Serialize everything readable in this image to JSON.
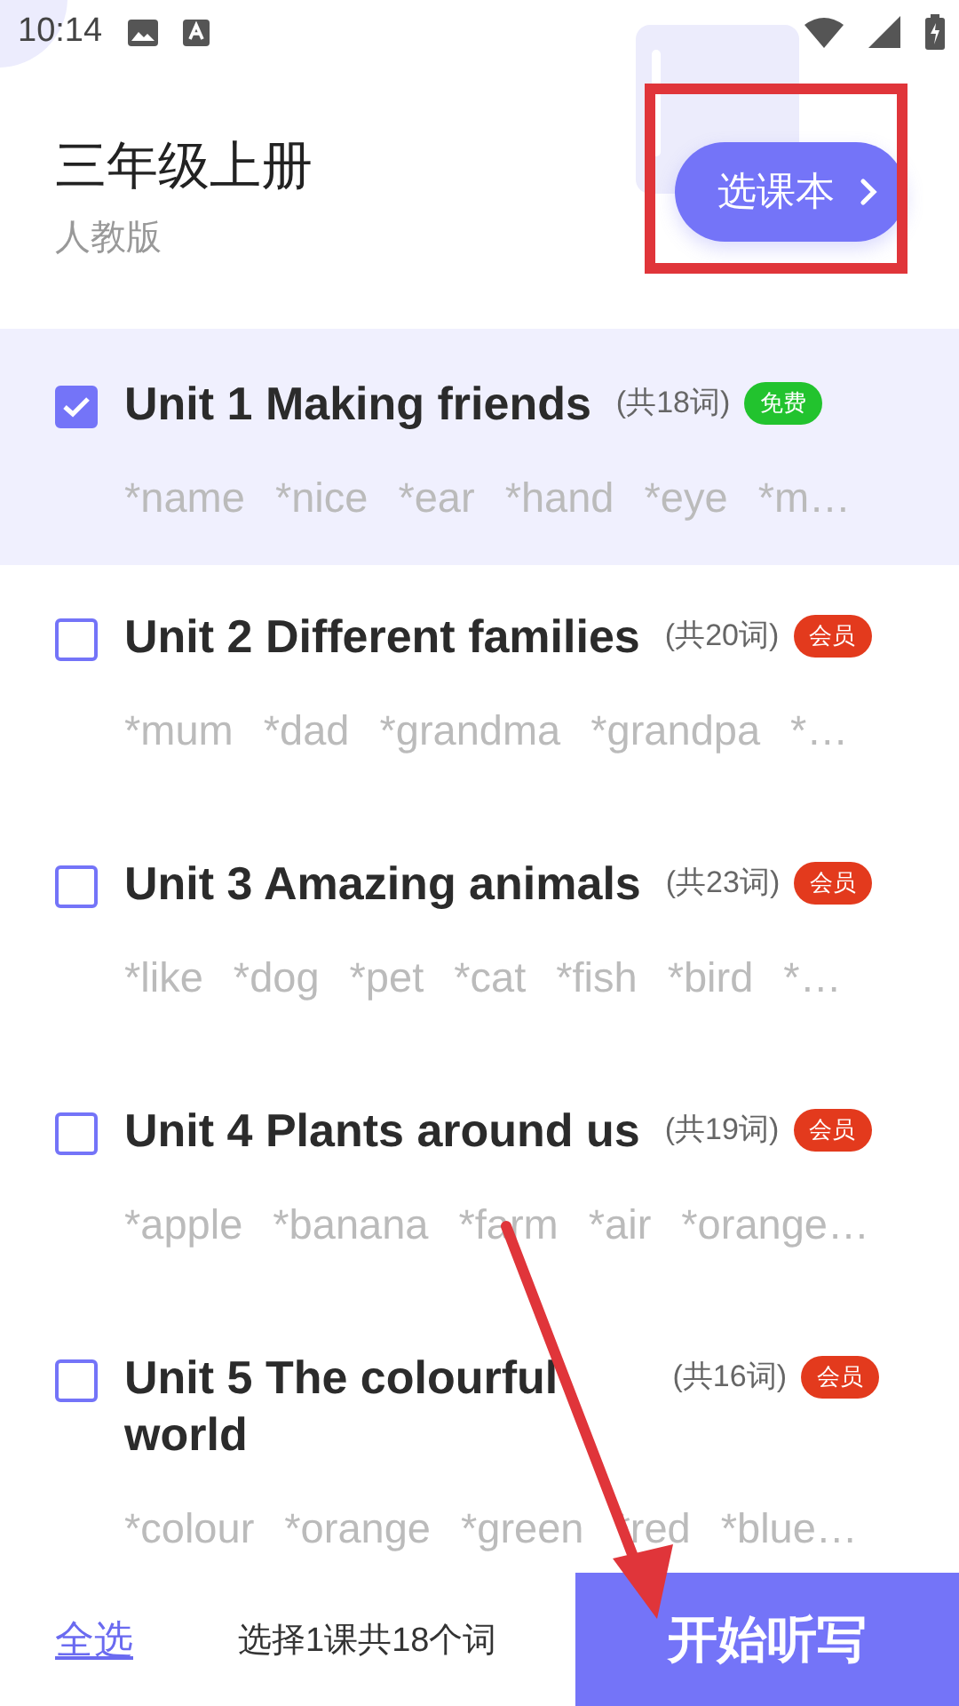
{
  "status_bar": {
    "time": "10:14"
  },
  "header": {
    "title": "三年级上册",
    "subtitle": "人教版",
    "choose_button": "选课本"
  },
  "units": [
    {
      "title": "Unit 1 Making friends",
      "count": "(共18词)",
      "badge": {
        "label": "免费",
        "color": "#22c32e"
      },
      "checked": true,
      "words": [
        "*name",
        "*nice",
        "*ear",
        "*hand",
        "*eye",
        "*m…"
      ]
    },
    {
      "title": "Unit 2 Different families",
      "count": "(共20词)",
      "badge": {
        "label": "会员",
        "color": "#e33a1d"
      },
      "checked": false,
      "words": [
        "*mum",
        "*dad",
        "*grandma",
        "*grandpa",
        "*…"
      ]
    },
    {
      "title": "Unit 3 Amazing animals",
      "count": "(共23词)",
      "badge": {
        "label": "会员",
        "color": "#e33a1d"
      },
      "checked": false,
      "words": [
        "*like",
        "*dog",
        "*pet",
        "*cat",
        "*fish",
        "*bird",
        "*…"
      ]
    },
    {
      "title": "Unit 4 Plants around us",
      "count": "(共19词)",
      "badge": {
        "label": "会员",
        "color": "#e33a1d"
      },
      "checked": false,
      "words": [
        "*apple",
        "*banana",
        "*farm",
        "*air",
        "*orange…"
      ]
    },
    {
      "title": "Unit 5 The colourful world",
      "count": "(共16词)",
      "badge": {
        "label": "会员",
        "color": "#e33a1d"
      },
      "checked": false,
      "words": [
        "*colour",
        "*orange",
        "*green",
        "*red",
        "*blue…"
      ]
    }
  ],
  "footer": {
    "select_all": "全选",
    "summary": "选择1课共18个词",
    "start_button": "开始听写"
  }
}
